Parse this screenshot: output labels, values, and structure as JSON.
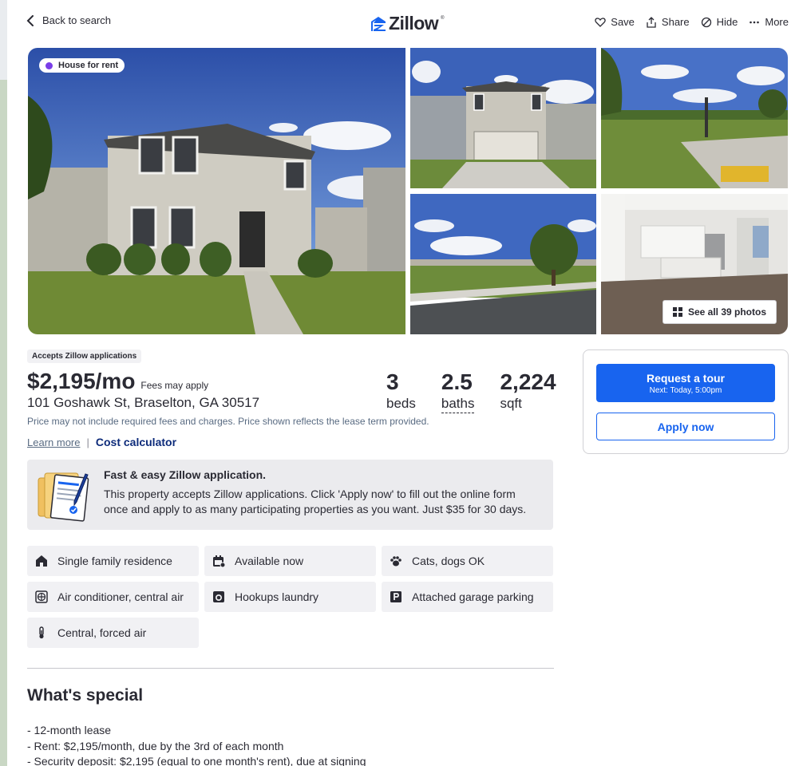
{
  "header": {
    "back_label": "Back to search",
    "logo_text": "Zillow",
    "logo_reg": "®",
    "actions": [
      {
        "label": "Save",
        "icon": "heart-icon"
      },
      {
        "label": "Share",
        "icon": "share-icon"
      },
      {
        "label": "Hide",
        "icon": "hide-icon"
      },
      {
        "label": "More",
        "icon": "more-icon"
      }
    ]
  },
  "gallery": {
    "status_tag": "House for rent",
    "status_color": "#7a3ee8",
    "see_all_label": "See all 39 photos"
  },
  "summary": {
    "accepts_badge": "Accepts Zillow applications",
    "price": "$2,195/mo",
    "fees_note": "Fees may apply",
    "address": "101 Goshawk St, Braselton, GA 30517",
    "stats": [
      {
        "num": "3",
        "label": "beds"
      },
      {
        "num": "2.5",
        "label": "baths"
      },
      {
        "num": "2,224",
        "label": "sqft"
      }
    ],
    "disclaimer": "Price may not include required fees and charges. Price shown reflects the lease term provided.",
    "learn_more": "Learn more",
    "separator": "|",
    "cost_calculator": "Cost calculator"
  },
  "side_card": {
    "tour_label": "Request a tour",
    "tour_sub": "Next: Today, 5:00pm",
    "apply_label": "Apply now",
    "accent": "#1864ef"
  },
  "promo": {
    "title": "Fast & easy Zillow application.",
    "body": "This property accepts Zillow applications. Click 'Apply now' to fill out the online form once and apply to as many participating properties as you want. Just $35 for 30 days."
  },
  "facts": [
    {
      "label": "Single family residence",
      "icon": "home-icon"
    },
    {
      "label": "Available now",
      "icon": "calendar-icon"
    },
    {
      "label": "Cats, dogs OK",
      "icon": "paw-icon"
    },
    {
      "label": "Air conditioner, central air",
      "icon": "snowflake-icon"
    },
    {
      "label": "Hookups laundry",
      "icon": "laundry-icon"
    },
    {
      "label": "Attached garage parking",
      "icon": "parking-icon"
    },
    {
      "label": "Central, forced air",
      "icon": "thermometer-icon"
    }
  ],
  "special": {
    "title": "What's special",
    "lines": [
      "- 12-month lease",
      "- Rent: $2,195/month, due by the 3rd of each month",
      "- Security deposit: $2,195 (equal to one month's rent), due at signing"
    ]
  }
}
